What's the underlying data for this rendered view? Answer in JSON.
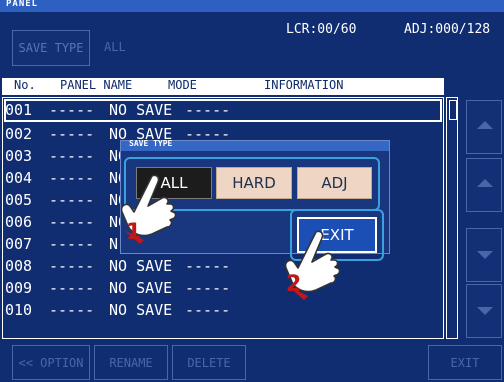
{
  "title": "PANEL",
  "toolbar": {
    "save_type_label": "SAVE TYPE",
    "save_type_value": "ALL",
    "lcr_status": "LCR:00/60",
    "adj_status": "ADJ:000/128"
  },
  "table": {
    "headers": [
      "No.",
      "PANEL NAME",
      "MODE",
      "INFORMATION"
    ],
    "rows": [
      {
        "no": "001",
        "name": "-----",
        "mode": "NO SAVE",
        "info": "-----"
      },
      {
        "no": "002",
        "name": "-----",
        "mode": "NO SAVE",
        "info": "-----"
      },
      {
        "no": "003",
        "name": "-----",
        "mode": "NO",
        "info": ""
      },
      {
        "no": "004",
        "name": "-----",
        "mode": "NO",
        "info": ""
      },
      {
        "no": "005",
        "name": "-----",
        "mode": "NO",
        "info": ""
      },
      {
        "no": "006",
        "name": "-----",
        "mode": "NO",
        "info": ""
      },
      {
        "no": "007",
        "name": "-----",
        "mode": "N",
        "info": ""
      },
      {
        "no": "008",
        "name": "-----",
        "mode": "NO SAVE",
        "info": "-----"
      },
      {
        "no": "009",
        "name": "-----",
        "mode": "NO SAVE",
        "info": "-----"
      },
      {
        "no": "010",
        "name": "-----",
        "mode": "NO SAVE",
        "info": "-----"
      }
    ]
  },
  "bottom": {
    "option_label": "<< OPTION",
    "rename_label": "RENAME",
    "delete_label": "DELETE",
    "exit_label": "EXIT"
  },
  "dialog": {
    "title": "SAVE TYPE",
    "options": [
      "ALL",
      "HARD",
      "ADJ"
    ],
    "exit_label": "EXIT"
  },
  "annotations": [
    "1",
    "2"
  ],
  "colors": {
    "background": "#112d72",
    "header_bg": "#ffffff",
    "exit_button": "#1b4fb6",
    "option_selected": "#1c1c1c",
    "option_normal": "#efd6c4",
    "highlight_frame": "#3aa0e0",
    "annotation_number": "#c01818"
  }
}
